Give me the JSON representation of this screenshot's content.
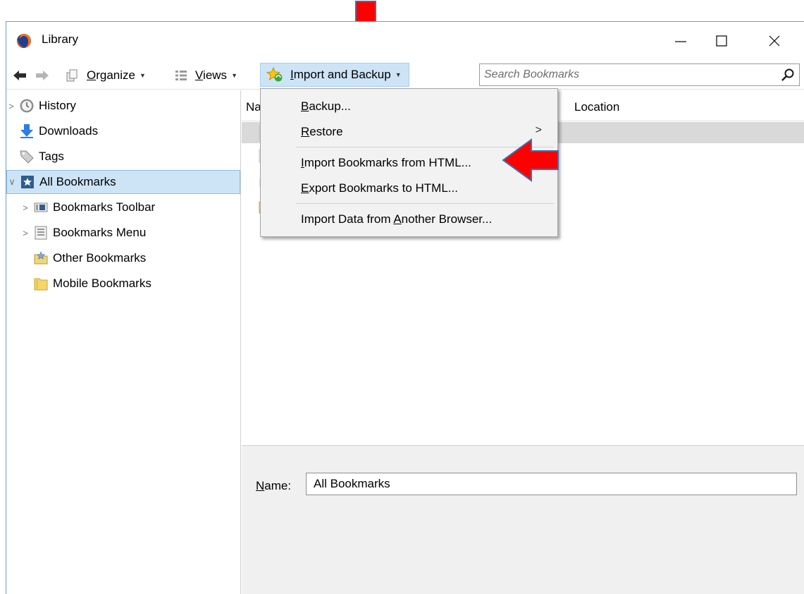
{
  "window": {
    "title": "Library"
  },
  "toolbar": {
    "organize": {
      "accel": "O",
      "rest": "rganize"
    },
    "views": {
      "accel": "V",
      "rest": "iews"
    },
    "import_backup": {
      "accel": "I",
      "rest": "mport and Backup"
    },
    "search_placeholder": "Search Bookmarks"
  },
  "sidebar": {
    "items": [
      {
        "label": "History",
        "icon": "history-clock-icon"
      },
      {
        "label": "Downloads",
        "icon": "download-arrow-icon"
      },
      {
        "label": "Tags",
        "icon": "tag-icon"
      },
      {
        "label": "All Bookmarks",
        "icon": "bookmarks-star-icon",
        "selected": true
      },
      {
        "label": "Bookmarks Toolbar",
        "icon": "toolbar-icon"
      },
      {
        "label": "Bookmarks Menu",
        "icon": "menu-list-icon"
      },
      {
        "label": "Other Bookmarks",
        "icon": "folder-star-icon"
      },
      {
        "label": "Mobile Bookmarks",
        "icon": "folder-icon"
      }
    ]
  },
  "content": {
    "col_name": "Na",
    "col_location": "Location"
  },
  "details": {
    "name_label_accel": "N",
    "name_label_rest": "ame:",
    "name_value": "All Bookmarks"
  },
  "menu": {
    "backup": {
      "accel": "B",
      "rest": "ackup..."
    },
    "restore": {
      "accel": "R",
      "rest": "estore"
    },
    "import_html": {
      "accel": "I",
      "rest": "mport Bookmarks from HTML..."
    },
    "export_html": {
      "accel": "E",
      "rest": "xport Bookmarks to HTML..."
    },
    "import_browser": {
      "pre": "Import Data from ",
      "accel": "A",
      "rest": "nother Browser..."
    }
  },
  "colors": {
    "selection": "#cde4f7",
    "annotation_arrow": "#ff0000"
  }
}
